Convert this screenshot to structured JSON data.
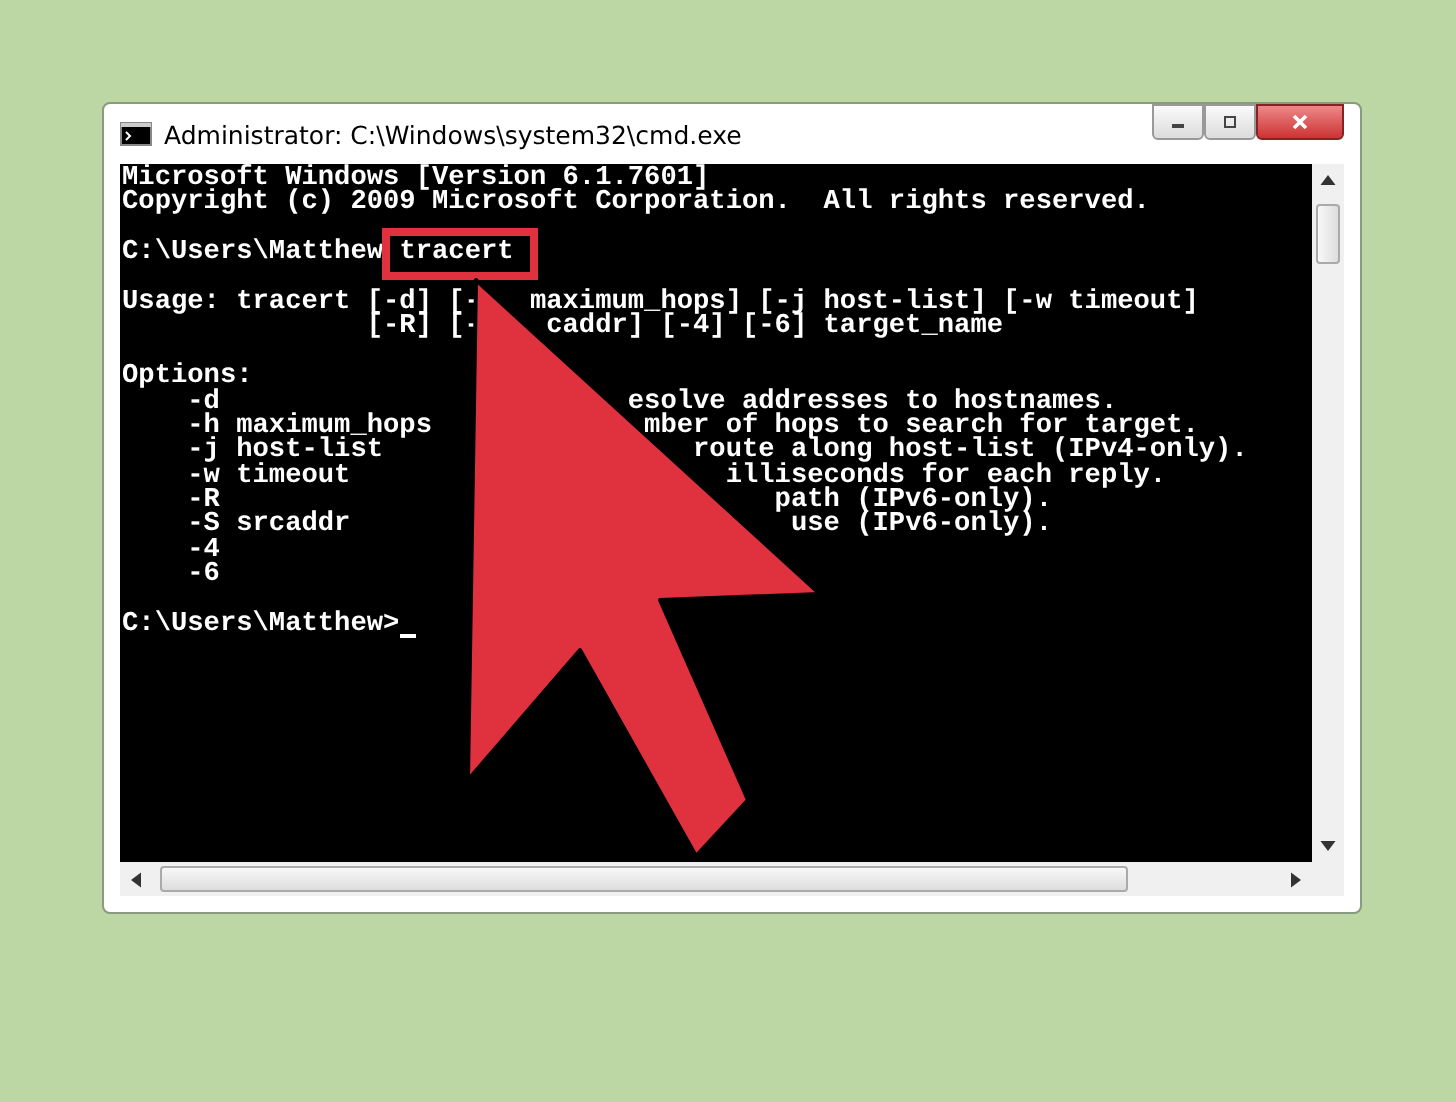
{
  "window": {
    "title": "Administrator: C:\\Windows\\system32\\cmd.exe"
  },
  "console": {
    "blocks": [
      [
        {
          "text": "Microsoft Windows [Version 6.1.7601]"
        },
        {
          "text": "Copyright (c) 2009 Microsoft Corporation.  All rights reserved."
        }
      ],
      [
        {
          "text": "C:\\Users\\Matthew",
          "boxed": "tracert"
        }
      ],
      [
        {
          "text": "Usage: tracert [-d] [-",
          "rest": "maximum_hops] [-j host-list] [-w timeout]"
        },
        {
          "text": "               [-R] [-",
          "rest": "caddr] [-4] [-6] target_name"
        }
      ],
      [
        {
          "text": "Options:"
        },
        {
          "text": "    -d",
          "rest": "esolve addresses to hostnames."
        },
        {
          "text": "    -h maximum_hops",
          "rest": "mber of hops to search for target."
        },
        {
          "text": "    -j host-list",
          "rest": "route along host-list (IPv4-only)."
        },
        {
          "text": "    -w timeout",
          "rest": "illiseconds for each reply."
        },
        {
          "text": "    -R",
          "rest": "path (IPv6-only)."
        },
        {
          "text": "    -S srcaddr",
          "rest": "use (IPv6-only)."
        },
        {
          "text": "    -4"
        },
        {
          "text": "    -6"
        }
      ],
      [
        {
          "text": "C:\\Users\\Matthew>",
          "cursor": true
        }
      ]
    ]
  }
}
